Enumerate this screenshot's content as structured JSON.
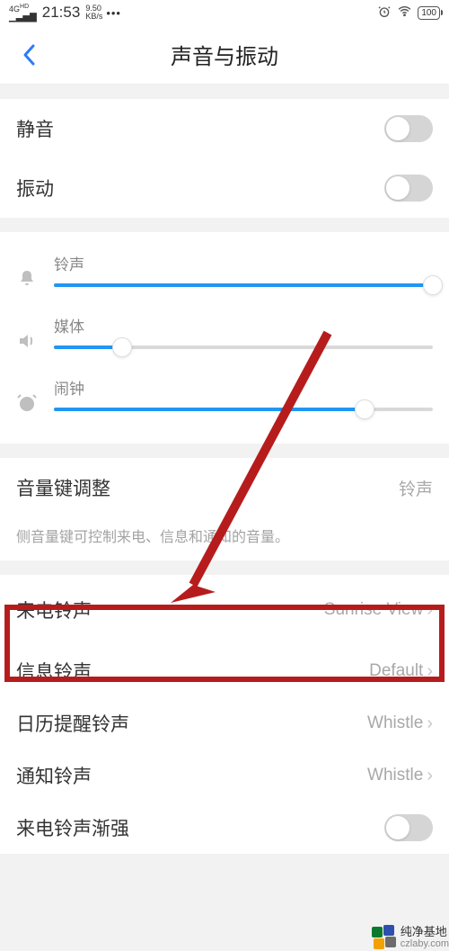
{
  "status": {
    "network": "4G",
    "hd": "HD",
    "time": "21:53",
    "speed_num": "9.50",
    "speed_unit": "KB/s",
    "battery": "100"
  },
  "header": {
    "title": "声音与振动"
  },
  "toggles": {
    "mute": {
      "label": "静音",
      "on": false
    },
    "vibrate": {
      "label": "振动",
      "on": false
    },
    "gradual": {
      "label": "来电铃声渐强",
      "on": false
    }
  },
  "volumes": {
    "ring": {
      "label": "铃声",
      "value": 100
    },
    "media": {
      "label": "媒体",
      "value": 18
    },
    "alarm": {
      "label": "闹钟",
      "value": 82
    }
  },
  "volume_key": {
    "label": "音量键调整",
    "value": "铃声",
    "help": "侧音量键可控制来电、信息和通知的音量。"
  },
  "ringtone_rows": {
    "incoming": {
      "label": "来电铃声",
      "value": "Sunrise View"
    },
    "message": {
      "label": "信息铃声",
      "value": "Default"
    },
    "calendar": {
      "label": "日历提醒铃声",
      "value": "Whistle"
    },
    "notify": {
      "label": "通知铃声",
      "value": "Whistle"
    }
  },
  "watermark": {
    "name": "纯净基地",
    "url": "czlaby.com"
  }
}
